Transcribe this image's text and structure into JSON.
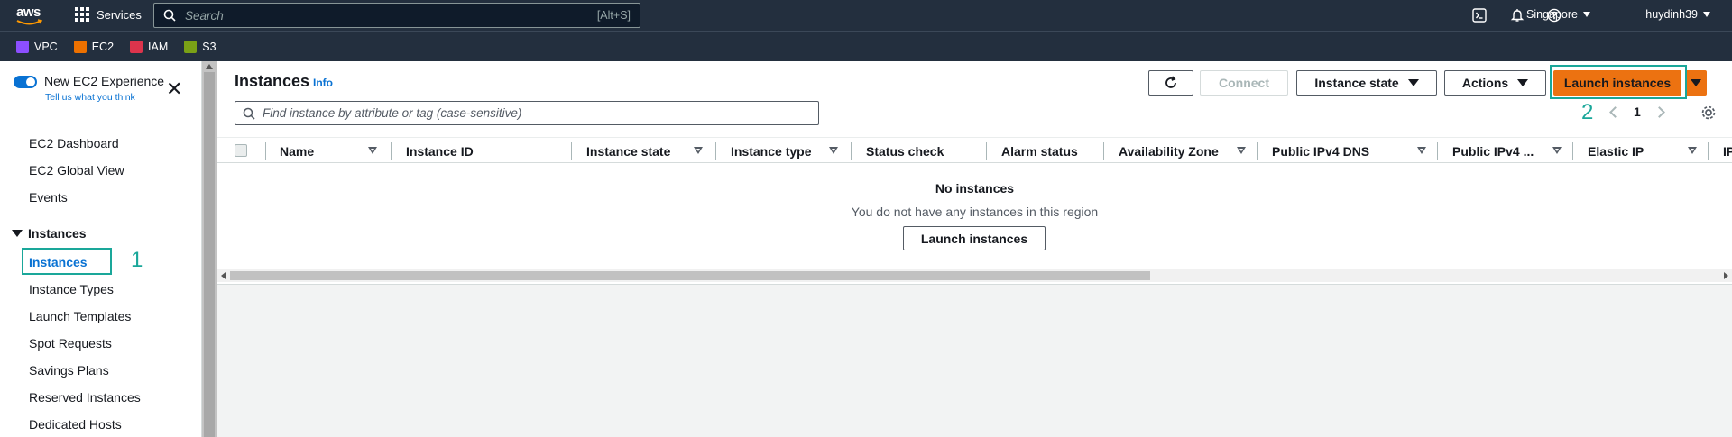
{
  "topnav": {
    "logo": "aws",
    "services_label": "Services",
    "search_placeholder": "Search",
    "search_shortcut": "[Alt+S]",
    "region": "Singapore",
    "user": "huydinh39"
  },
  "favorites": [
    {
      "label": "VPC",
      "color": "#8c4fff"
    },
    {
      "label": "EC2",
      "color": "#ed7100"
    },
    {
      "label": "IAM",
      "color": "#dd344c"
    },
    {
      "label": "S3",
      "color": "#7aa116"
    }
  ],
  "sidebar": {
    "toggle_title": "New EC2 Experience",
    "toggle_sub": "Tell us what you think",
    "items_top": [
      "EC2 Dashboard",
      "EC2 Global View",
      "Events"
    ],
    "group": "Instances",
    "active": "Instances",
    "items_group": [
      "Instance Types",
      "Launch Templates",
      "Spot Requests",
      "Savings Plans",
      "Reserved Instances",
      "Dedicated Hosts"
    ],
    "annotation": "1"
  },
  "main": {
    "title": "Instances",
    "info": "Info",
    "connect": "Connect",
    "instance_state": "Instance state",
    "actions": "Actions",
    "launch": "Launch instances",
    "annotation": "2",
    "filter_placeholder": "Find instance by attribute or tag (case-sensitive)",
    "page": "1",
    "columns": [
      "Name",
      "Instance ID",
      "Instance state",
      "Instance type",
      "Status check",
      "Alarm status",
      "Availability Zone",
      "Public IPv4 DNS",
      "Public IPv4 ...",
      "Elastic IP",
      "IP"
    ],
    "empty_title": "No instances",
    "empty_sub": "You do not have any instances in this region",
    "empty_button": "Launch instances"
  },
  "colors": {
    "nav_bg": "#232f3e",
    "primary": "#ec7211",
    "link": "#0972d3",
    "annotation": "#1aa79a"
  }
}
